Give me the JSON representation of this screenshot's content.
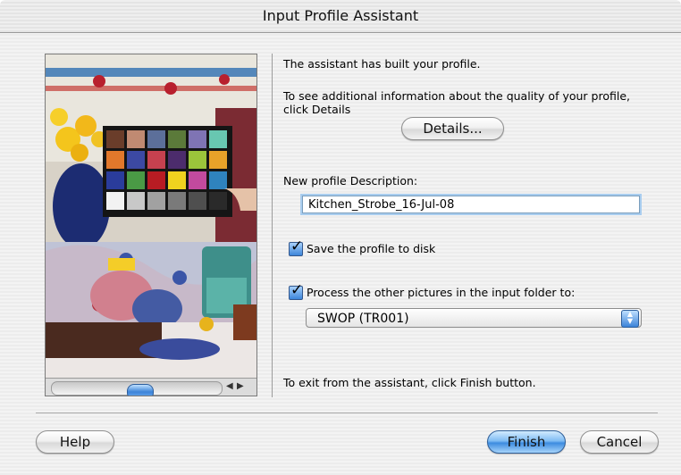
{
  "window": {
    "title": "Input Profile Assistant"
  },
  "preview": {
    "palette_colors": [
      "#6a3d2a",
      "#c08a72",
      "#5c6f9a",
      "#5b7a3a",
      "#7f74b4",
      "#68c7b1",
      "#e2782b",
      "#3c49a3",
      "#c6414f",
      "#4c2c6c",
      "#9bc43b",
      "#e8a229",
      "#2a3c9b",
      "#4a9a45",
      "#b81c23",
      "#f0d21f",
      "#c24a9e",
      "#2f83be",
      "#f2f2f2",
      "#c8c8c8",
      "#a1a1a1",
      "#7a7a7a",
      "#4f4f4f",
      "#2a2a2a"
    ]
  },
  "content": {
    "built_message": "The assistant has built your profile.",
    "details_info_line1": "To see additional information about the quality of your profile,",
    "details_info_line2": "click Details",
    "details_button": "Details...",
    "description_label": "New profile Description:",
    "description_value": "Kitchen_Strobe_16-Jul-08",
    "save_checkbox_label": "Save the profile to disk",
    "save_checked": true,
    "process_checkbox_label": "Process the other pictures in the input folder to:",
    "process_checked": true,
    "output_profile_selected": "SWOP (TR001)",
    "exit_message": "To exit from the assistant, click Finish button."
  },
  "buttons": {
    "help": "Help",
    "finish": "Finish",
    "cancel": "Cancel"
  }
}
